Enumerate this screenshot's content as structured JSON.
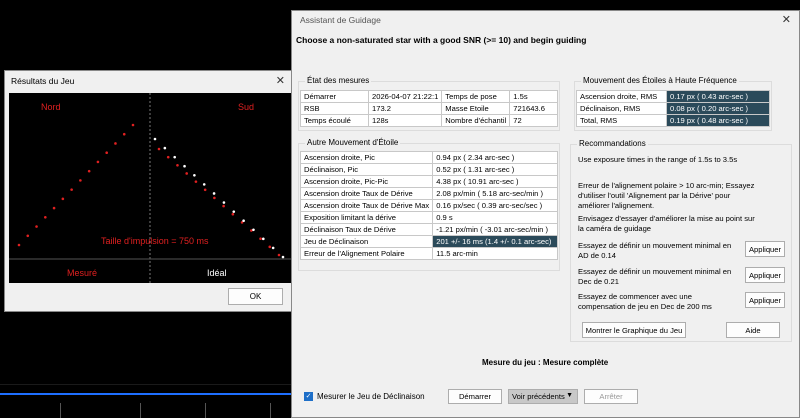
{
  "small_dialog": {
    "title": "Résultats du Jeu",
    "north_label": "Nord",
    "south_label": "Sud",
    "pulse_label": "Taille d'impulsion = 750 ms",
    "measured_label": "Mesuré",
    "ideal_label": "Idéal",
    "ok_label": "OK",
    "colors": {
      "measured": "#e02020",
      "ideal": "#ffffff"
    }
  },
  "main_dialog": {
    "title": "Assistant de Guidage",
    "instruction": "Choose a non-saturated star with a good SNR (>= 10) and begin guiding",
    "etat": {
      "label": "État des mesures",
      "rows": [
        [
          "Démarrer",
          "2026-04-07 21:22:1",
          "Temps de pose",
          "1.5s"
        ],
        [
          "RSB",
          "173.2",
          "Masse Etoile",
          "721643.6"
        ],
        [
          "Temps écoulé",
          "128s",
          "Nombre d'échantil",
          "72"
        ]
      ]
    },
    "hf": {
      "label": "Mouvement des Étoiles à Haute Fréquence",
      "rows": [
        [
          "Ascension droite, RMS",
          "0.17 px ( 0.43 arc-sec )"
        ],
        [
          "Déclinaison, RMS",
          "0.08 px ( 0.20 arc-sec )"
        ],
        [
          "Total, RMS",
          "0.19 px ( 0.48 arc-sec )"
        ]
      ]
    },
    "autre": {
      "label": "Autre Mouvement d'Étoile",
      "rows": [
        [
          "Ascension droite, Pic",
          "0.94 px ( 2.34 arc-sec )"
        ],
        [
          "Déclinaison, Pic",
          "0.52 px ( 1.31 arc-sec )"
        ],
        [
          "Ascension droite, Pic-Pic",
          "4.38 px ( 10.91 arc-sec )"
        ],
        [
          "Ascension droite Taux de Dérive",
          "2.08 px/min ( 5.18 arc-sec/min )"
        ],
        [
          "Ascension droite Taux de Dérive Max",
          "0.16 px/sec ( 0.39 arc-sec/sec )"
        ],
        [
          "Exposition limitant la dérive",
          "0.9 s"
        ],
        [
          "Déclinaison Taux de Dérive",
          "-1.21 px/min ( -3.01 arc-sec/min )"
        ],
        [
          "Jeu de Déclinaison",
          "201 +/- 16 ms (1.4 +/- 0.1 arc-sec)"
        ],
        [
          "Erreur de l'Alignement Polaire",
          "11.5 arc-min"
        ]
      ]
    },
    "reco": {
      "label": "Recommandations",
      "exposure": "Use exposure times in the range of 1.5s to 3.5s",
      "polar": "Erreur de l'alignement polaire > 10 arc-min; Essayez d'utiliser l'outil 'Alignement par la Dérive' pour améliorer l'alignement.",
      "camera": "Envisagez d'essayer d'améliorer la mise au point sur la caméra de guidage",
      "ra_min": "Essayez de définir un mouvement minimal en AD de 0.14",
      "dec_min": "Essayez de définir un mouvement minimal en Dec de 0.21",
      "backlash": "Essayez de commencer avec une compensation de jeu en Dec de 200 ms",
      "apply_label": "Appliquer",
      "show_graph_label": "Montrer le Graphique du Jeu",
      "help_label": "Aide"
    },
    "status": "Mesure du jeu : Mesure complète",
    "measure_backlash_label": "Mesurer le Jeu de Déclinaison",
    "start_label": "Démarrer",
    "prev_label": "Voir précédents",
    "stop_label": "Arrêter"
  }
}
